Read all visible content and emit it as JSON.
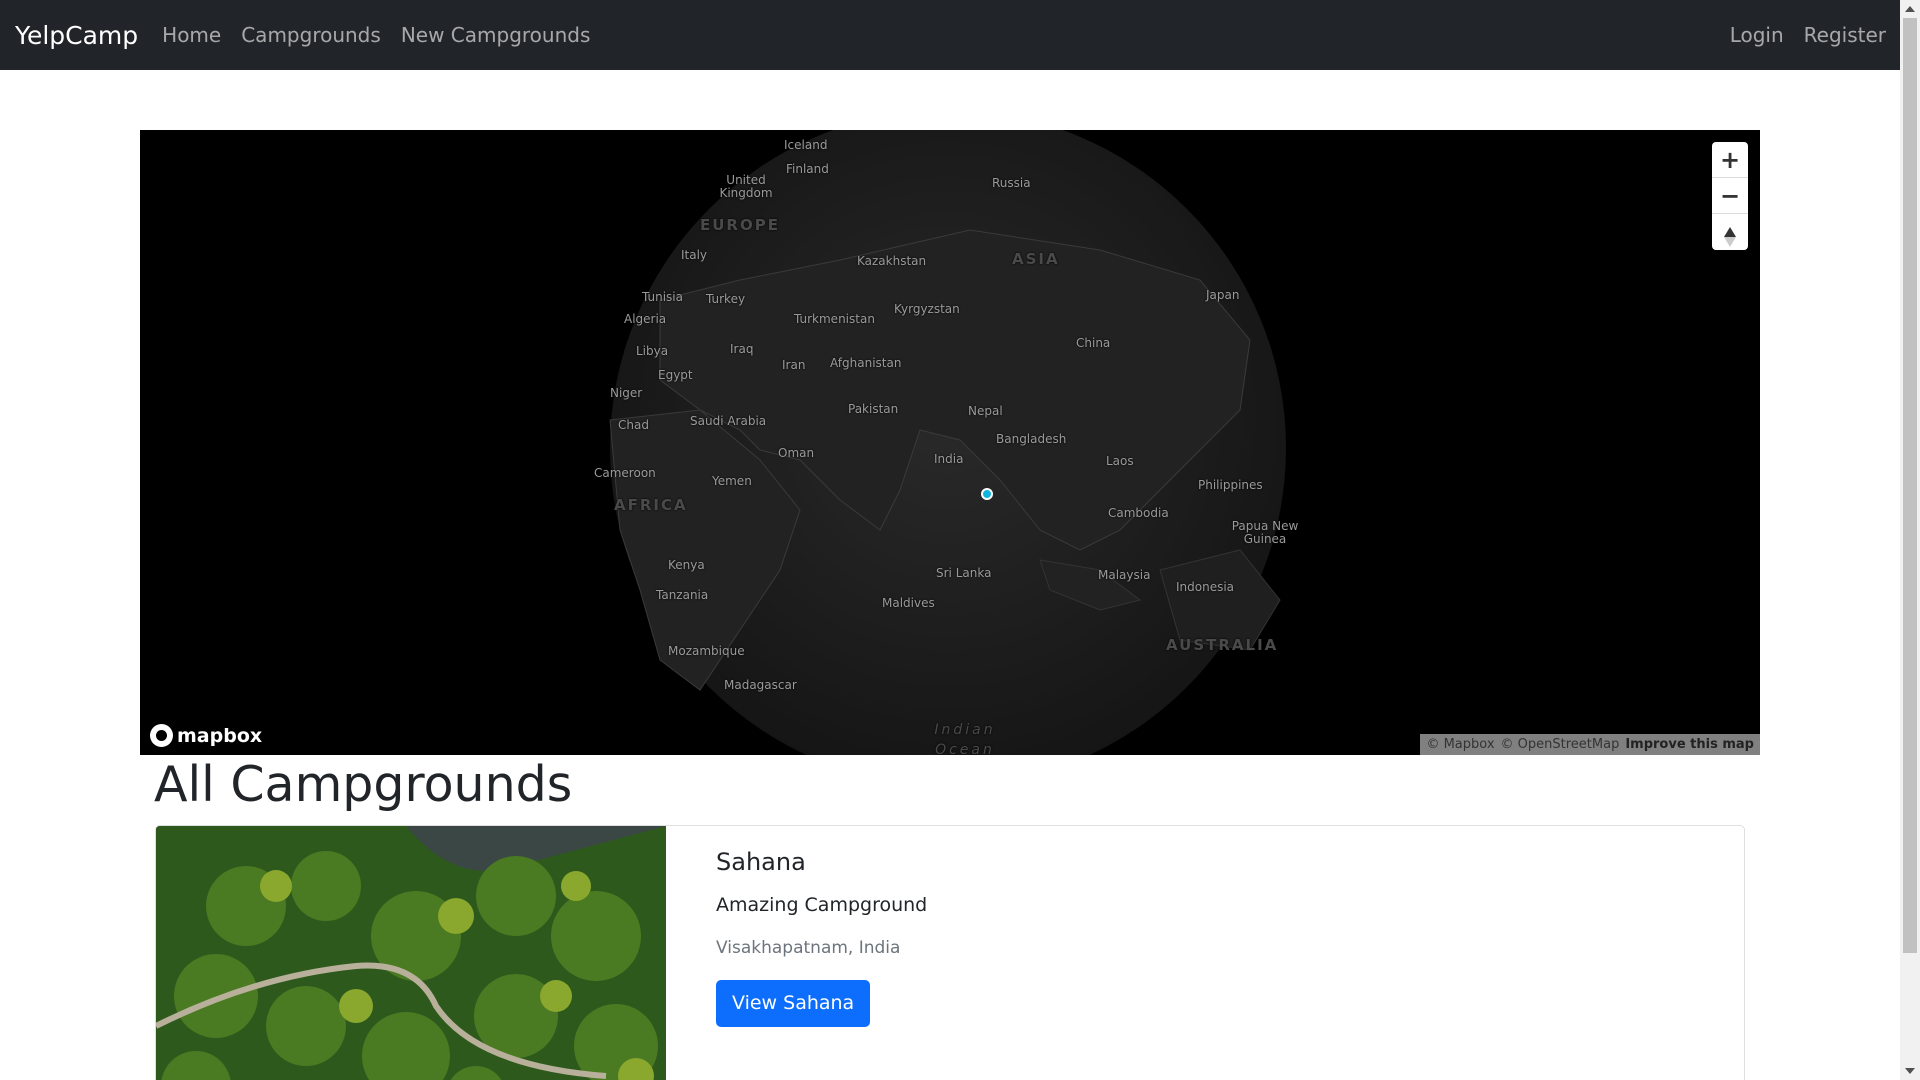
{
  "navbar": {
    "brand": "YelpCamp",
    "links": [
      "Home",
      "Campgrounds",
      "New Campgrounds"
    ],
    "auth_links": [
      "Login",
      "Register"
    ]
  },
  "map": {
    "labels": {
      "iceland": "Iceland",
      "finland": "Finland",
      "uk": "United Kingdom",
      "russia": "Russia",
      "europe": "EUROPE",
      "italy": "Italy",
      "kazakhstan": "Kazakhstan",
      "asia": "ASIA",
      "tunisia": "Tunisia",
      "turkey": "Turkey",
      "japan": "Japan",
      "algeria": "Algeria",
      "turkmenistan": "Turkmenistan",
      "kyrgyzstan": "Kyrgyzstan",
      "libya": "Libya",
      "iraq": "Iraq",
      "china": "China",
      "iran": "Iran",
      "afghanistan": "Afghanistan",
      "egypt": "Egypt",
      "niger": "Niger",
      "pakistan": "Pakistan",
      "nepal": "Nepal",
      "chad": "Chad",
      "saudi": "Saudi Arabia",
      "bangladesh": "Bangladesh",
      "oman": "Oman",
      "india": "India",
      "laos": "Laos",
      "cameroon": "Cameroon",
      "yemen": "Yemen",
      "philippines": "Philippines",
      "africa": "AFRICA",
      "cambodia": "Cambodia",
      "png": "Papua New Guinea",
      "kenya": "Kenya",
      "srilanka": "Sri Lanka",
      "malaysia": "Malaysia",
      "indonesia": "Indonesia",
      "tanzania": "Tanzania",
      "maldives": "Maldives",
      "australia": "AUSTRALIA",
      "mozambique": "Mozambique",
      "madagascar": "Madagascar",
      "indian_ocean": "Indian Ocean"
    },
    "controls": {
      "zoom_in": "+",
      "zoom_out": "−"
    },
    "logo_text": "mapbox",
    "attribution": {
      "mapbox": "© Mapbox",
      "osm": "© OpenStreetMap",
      "improve": "Improve this map"
    },
    "marker_color": "#11b4da"
  },
  "page_title": "All Campgrounds",
  "campgrounds": [
    {
      "title": "Sahana",
      "description": "Amazing Campground",
      "location": "Visakhapatnam, India",
      "button_label": "View Sahana"
    }
  ],
  "colors": {
    "navbar_bg": "#212529",
    "primary": "#0d6efd",
    "map_bg": "#000000"
  }
}
